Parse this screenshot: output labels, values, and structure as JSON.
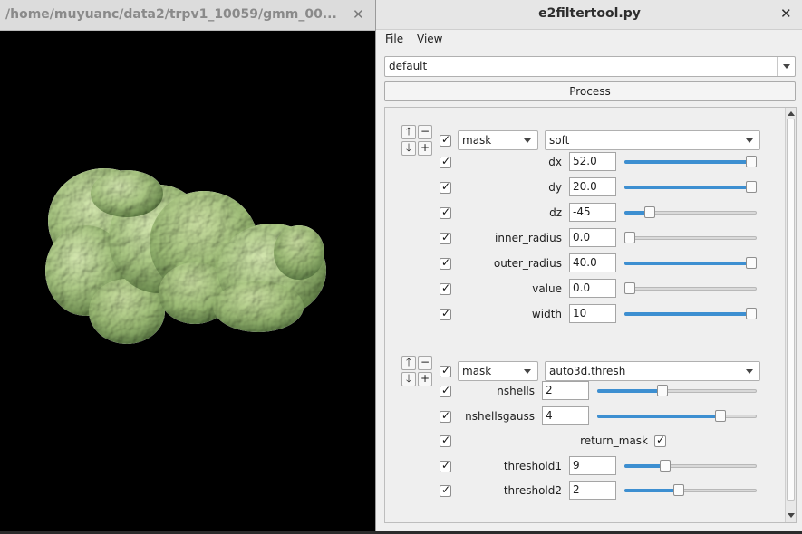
{
  "viewer": {
    "title": "/home/muyuanc/data2/trpv1_10059/gmm_00...",
    "close_glyph": "✕"
  },
  "tool": {
    "title": "e2filtertool.py",
    "close_glyph": "✕",
    "menu": [
      "File",
      "View"
    ],
    "preset_value": "default",
    "process_label": "Process"
  },
  "groups": [
    {
      "filter_type": "mask",
      "filter_name": "soft",
      "params": [
        {
          "label": "dx",
          "value": "52.0",
          "slider": 1.0
        },
        {
          "label": "dy",
          "value": "20.0",
          "slider": 1.0
        },
        {
          "label": "dz",
          "value": "-45",
          "slider": 0.19
        },
        {
          "label": "inner_radius",
          "value": "0.0",
          "slider": 0.0
        },
        {
          "label": "outer_radius",
          "value": "40.0",
          "slider": 1.0
        },
        {
          "label": "value",
          "value": "0.0",
          "slider": 0.0
        },
        {
          "label": "width",
          "value": "10",
          "slider": 1.0
        }
      ]
    },
    {
      "filter_type": "mask",
      "filter_name": "auto3d.thresh",
      "params": [
        {
          "label": "nshells",
          "value": "2",
          "slider": 0.41
        },
        {
          "label": "nshellsgauss",
          "value": "4",
          "slider": 0.77
        },
        {
          "label": "return_mask",
          "checkbox": true
        },
        {
          "label": "threshold1",
          "value": "9",
          "slider": 0.31
        },
        {
          "label": "threshold2",
          "value": "2",
          "slider": 0.41
        }
      ]
    }
  ],
  "buttons": {
    "up": "🡑",
    "down": "🡓",
    "minus": "−",
    "plus": "+"
  },
  "colors": {
    "accent": "#3d8fd1",
    "blob": "#b6d38d",
    "viewer_bg": "#000000"
  }
}
